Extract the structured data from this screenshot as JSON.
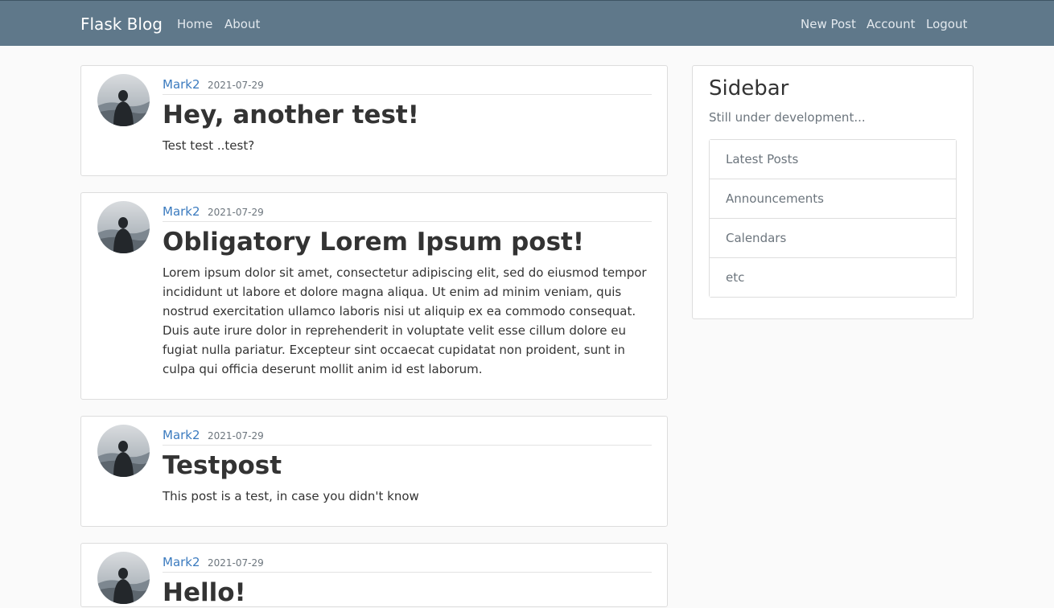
{
  "navbar": {
    "brand": "Flask Blog",
    "left_links": [
      "Home",
      "About"
    ],
    "right_links": [
      "New Post",
      "Account",
      "Logout"
    ],
    "background": "#5f788a"
  },
  "posts": [
    {
      "author": "Mark2",
      "date": "2021-07-29",
      "title": "Hey, another test!",
      "content": "Test test ..test?"
    },
    {
      "author": "Mark2",
      "date": "2021-07-29",
      "title": "Obligatory Lorem Ipsum post!",
      "content": "Lorem ipsum dolor sit amet, consectetur adipiscing elit, sed do eiusmod tempor incididunt ut labore et dolore magna aliqua. Ut enim ad minim veniam, quis nostrud exercitation ullamco laboris nisi ut aliquip ex ea commodo consequat. Duis aute irure dolor in reprehenderit in voluptate velit esse cillum dolore eu fugiat nulla pariatur. Excepteur sint occaecat cupidatat non proident, sunt in culpa qui officia deserunt mollit anim id est laborum."
    },
    {
      "author": "Mark2",
      "date": "2021-07-29",
      "title": "Testpost",
      "content": "This post is a test, in case you didn't know"
    },
    {
      "author": "Mark2",
      "date": "2021-07-29",
      "title": "Hello!",
      "content": ""
    }
  ],
  "sidebar": {
    "title": "Sidebar",
    "subtitle": "Still under development...",
    "items": [
      "Latest Posts",
      "Announcements",
      "Calendars",
      "etc"
    ]
  },
  "colors": {
    "link": "#3b7bbf",
    "muted": "#6c757d",
    "page_bg": "#fafafa"
  },
  "icons": {
    "avatar": "user-avatar-silhouette"
  }
}
